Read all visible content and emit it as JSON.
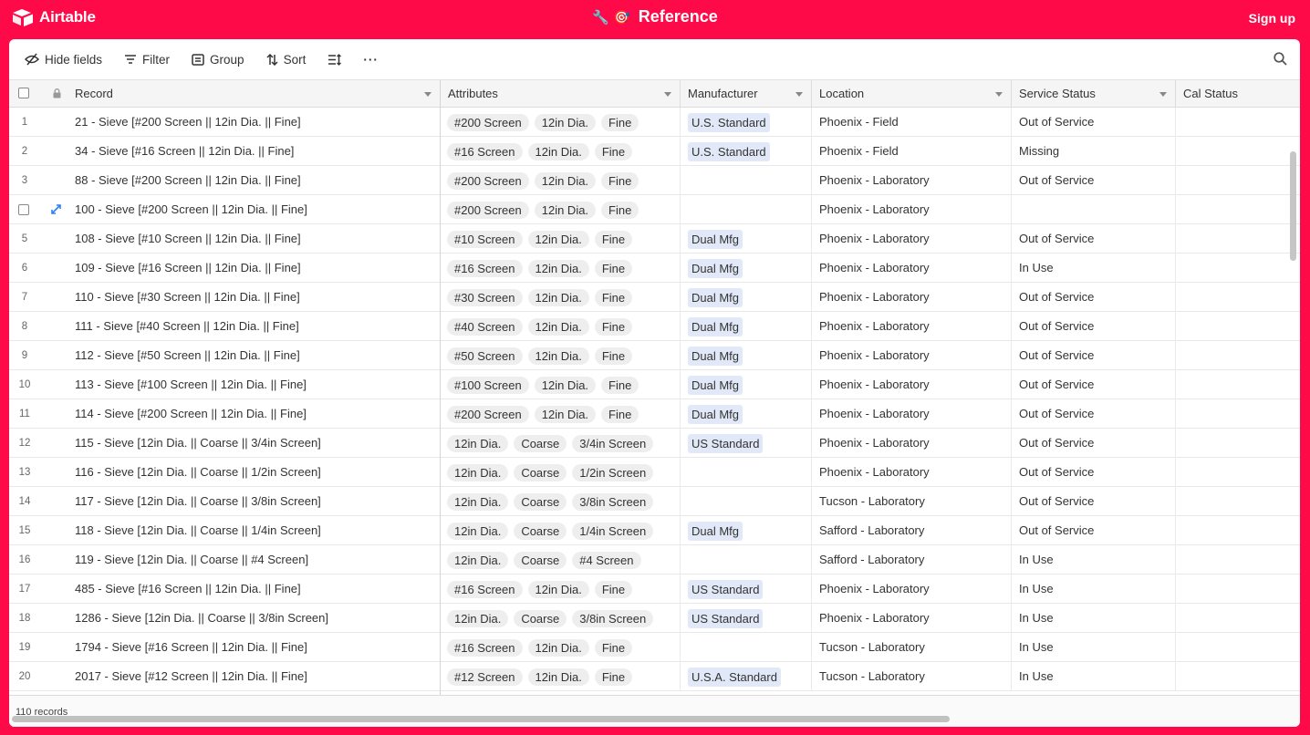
{
  "app": {
    "logo_text": "Airtable",
    "title": "Reference",
    "title_emoji": "🔧 🎯",
    "signup_label": "Sign up"
  },
  "colors": {
    "brand": "#fe0a49",
    "pill_bg": "#eeeeee",
    "manufacturer_pill_bg": "#e1e9f8"
  },
  "toolbar": {
    "hide_fields": "Hide fields",
    "filter": "Filter",
    "group": "Group",
    "sort": "Sort",
    "more": "···"
  },
  "columns": {
    "record": "Record",
    "attributes": "Attributes",
    "manufacturer": "Manufacturer",
    "location": "Location",
    "service_status": "Service Status",
    "cal_status": "Cal Status"
  },
  "rows": [
    {
      "num": "1",
      "record": "21 - Sieve [#200 Screen || 12in Dia. || Fine]",
      "attributes": [
        "#200 Screen",
        "12in Dia.",
        "Fine"
      ],
      "manufacturer": "U.S. Standard",
      "location": "Phoenix - Field",
      "status": "Out of Service"
    },
    {
      "num": "2",
      "record": "34 - Sieve [#16 Screen || 12in Dia. || Fine]",
      "attributes": [
        "#16 Screen",
        "12in Dia.",
        "Fine"
      ],
      "manufacturer": "U.S. Standard",
      "location": "Phoenix - Field",
      "status": "Missing"
    },
    {
      "num": "3",
      "record": "88 - Sieve [#200 Screen || 12in Dia. || Fine]",
      "attributes": [
        "#200 Screen",
        "12in Dia.",
        "Fine"
      ],
      "manufacturer": "",
      "location": "Phoenix - Laboratory",
      "status": "Out of Service"
    },
    {
      "num": "",
      "record": "100 - Sieve [#200 Screen || 12in Dia. || Fine]",
      "attributes": [
        "#200 Screen",
        "12in Dia.",
        "Fine"
      ],
      "manufacturer": "",
      "location": "Phoenix - Laboratory",
      "status": ""
    },
    {
      "num": "5",
      "record": "108 - Sieve [#10 Screen || 12in Dia. || Fine]",
      "attributes": [
        "#10 Screen",
        "12in Dia.",
        "Fine"
      ],
      "manufacturer": "Dual Mfg",
      "location": "Phoenix - Laboratory",
      "status": "Out of Service"
    },
    {
      "num": "6",
      "record": "109 - Sieve [#16 Screen || 12in Dia. || Fine]",
      "attributes": [
        "#16 Screen",
        "12in Dia.",
        "Fine"
      ],
      "manufacturer": "Dual Mfg",
      "location": "Phoenix - Laboratory",
      "status": "In Use"
    },
    {
      "num": "7",
      "record": "110 - Sieve [#30 Screen || 12in Dia. || Fine]",
      "attributes": [
        "#30 Screen",
        "12in Dia.",
        "Fine"
      ],
      "manufacturer": "Dual Mfg",
      "location": "Phoenix - Laboratory",
      "status": "Out of Service"
    },
    {
      "num": "8",
      "record": "111 - Sieve [#40 Screen || 12in Dia. || Fine]",
      "attributes": [
        "#40 Screen",
        "12in Dia.",
        "Fine"
      ],
      "manufacturer": "Dual Mfg",
      "location": "Phoenix - Laboratory",
      "status": "Out of Service"
    },
    {
      "num": "9",
      "record": "112 - Sieve [#50 Screen || 12in Dia. || Fine]",
      "attributes": [
        "#50 Screen",
        "12in Dia.",
        "Fine"
      ],
      "manufacturer": "Dual Mfg",
      "location": "Phoenix - Laboratory",
      "status": "Out of Service"
    },
    {
      "num": "10",
      "record": "113 - Sieve [#100 Screen || 12in Dia. || Fine]",
      "attributes": [
        "#100 Screen",
        "12in Dia.",
        "Fine"
      ],
      "manufacturer": "Dual Mfg",
      "location": "Phoenix - Laboratory",
      "status": "Out of Service"
    },
    {
      "num": "11",
      "record": "114 - Sieve [#200 Screen || 12in Dia. || Fine]",
      "attributes": [
        "#200 Screen",
        "12in Dia.",
        "Fine"
      ],
      "manufacturer": "Dual Mfg",
      "location": "Phoenix - Laboratory",
      "status": "Out of Service"
    },
    {
      "num": "12",
      "record": "115 - Sieve [12in Dia. || Coarse || 3/4in Screen]",
      "attributes": [
        "12in Dia.",
        "Coarse",
        "3/4in Screen"
      ],
      "manufacturer": "US Standard",
      "location": "Phoenix - Laboratory",
      "status": "Out of Service"
    },
    {
      "num": "13",
      "record": "116 - Sieve [12in Dia. || Coarse || 1/2in Screen]",
      "attributes": [
        "12in Dia.",
        "Coarse",
        "1/2in Screen"
      ],
      "manufacturer": "",
      "location": "Phoenix - Laboratory",
      "status": "Out of Service"
    },
    {
      "num": "14",
      "record": "117 - Sieve [12in Dia. || Coarse || 3/8in Screen]",
      "attributes": [
        "12in Dia.",
        "Coarse",
        "3/8in Screen"
      ],
      "manufacturer": "",
      "location": "Tucson - Laboratory",
      "status": "Out of Service"
    },
    {
      "num": "15",
      "record": "118 - Sieve [12in Dia. || Coarse || 1/4in Screen]",
      "attributes": [
        "12in Dia.",
        "Coarse",
        "1/4in Screen"
      ],
      "manufacturer": "Dual Mfg",
      "location": "Safford - Laboratory",
      "status": "Out of Service"
    },
    {
      "num": "16",
      "record": "119 - Sieve [12in Dia. || Coarse || #4 Screen]",
      "attributes": [
        "12in Dia.",
        "Coarse",
        "#4 Screen"
      ],
      "manufacturer": "",
      "location": "Safford - Laboratory",
      "status": "In Use"
    },
    {
      "num": "17",
      "record": "485 - Sieve [#16 Screen || 12in Dia. || Fine]",
      "attributes": [
        "#16 Screen",
        "12in Dia.",
        "Fine"
      ],
      "manufacturer": "US Standard",
      "location": "Phoenix - Laboratory",
      "status": "In Use"
    },
    {
      "num": "18",
      "record": "1286 - Sieve [12in Dia. || Coarse || 3/8in Screen]",
      "attributes": [
        "12in Dia.",
        "Coarse",
        "3/8in Screen"
      ],
      "manufacturer": "US Standard",
      "location": "Phoenix - Laboratory",
      "status": "In Use"
    },
    {
      "num": "19",
      "record": "1794 - Sieve [#16 Screen || 12in Dia. || Fine]",
      "attributes": [
        "#16 Screen",
        "12in Dia.",
        "Fine"
      ],
      "manufacturer": "",
      "location": "Tucson - Laboratory",
      "status": "In Use"
    },
    {
      "num": "20",
      "record": "2017 - Sieve [#12 Screen || 12in Dia. || Fine]",
      "attributes": [
        "#12 Screen",
        "12in Dia.",
        "Fine"
      ],
      "manufacturer": "U.S.A. Standard",
      "location": "Tucson - Laboratory",
      "status": "In Use"
    }
  ],
  "footer": {
    "record_count": "110 records"
  }
}
